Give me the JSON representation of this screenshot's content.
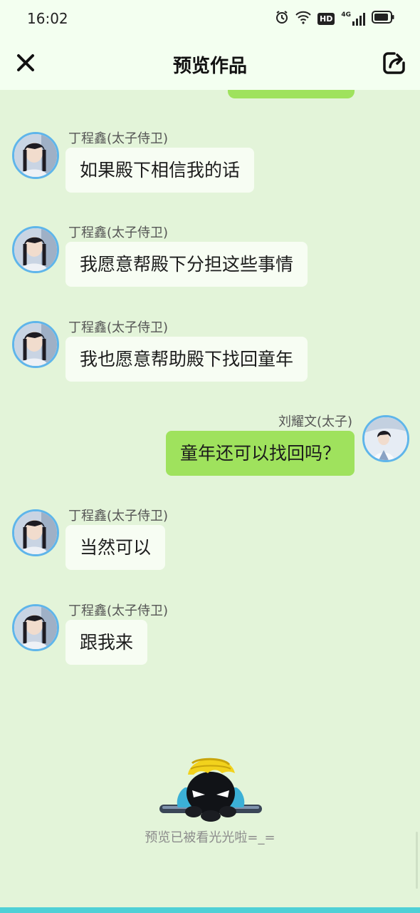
{
  "status_bar": {
    "time": "16:02",
    "icons": [
      "alarm-icon",
      "wifi-icon",
      "hd-icon",
      "signal-4g-icon",
      "battery-icon"
    ],
    "network_type": "4G",
    "hd_label": "HD"
  },
  "header": {
    "title": "预览作品",
    "close_icon": "close-icon",
    "share_icon": "share-icon"
  },
  "messages": [
    {
      "side": "left",
      "sender": "丁程鑫(太子侍卫)",
      "text": "如果殿下相信我的话"
    },
    {
      "side": "left",
      "sender": "丁程鑫(太子侍卫)",
      "text": "我愿意帮殿下分担这些事情"
    },
    {
      "side": "left",
      "sender": "丁程鑫(太子侍卫)",
      "text": "我也愿意帮助殿下找回童年"
    },
    {
      "side": "right",
      "sender": "刘耀文(太子)",
      "text": "童年还可以找回吗？"
    },
    {
      "side": "left",
      "sender": "丁程鑫(太子侍卫)",
      "text": "当然可以"
    },
    {
      "side": "left",
      "sender": "丁程鑫(太子侍卫)",
      "text": "跟我来"
    }
  ],
  "end_text": "预览已被看光光啦=_=",
  "colors": {
    "background": "#e3f4d9",
    "left_bubble": "#f7fdf3",
    "right_bubble": "#9fe25d",
    "avatar_ring": "#5fb5ea",
    "header_bg": "#f3fff0"
  }
}
